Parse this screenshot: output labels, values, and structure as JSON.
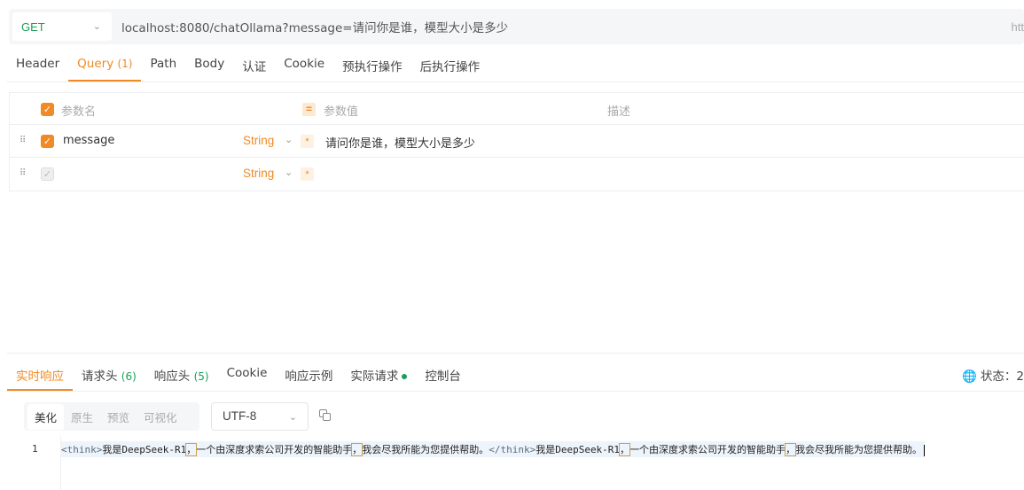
{
  "request": {
    "method": "GET",
    "url": "localhost:8080/chatOllama?message=请问你是谁，模型大小是多少",
    "url_overflow": "htt"
  },
  "request_tabs": [
    {
      "label": "Header",
      "count": ""
    },
    {
      "label": "Query",
      "count": "(1)"
    },
    {
      "label": "Path",
      "count": ""
    },
    {
      "label": "Body",
      "count": ""
    },
    {
      "label": "认证",
      "count": ""
    },
    {
      "label": "Cookie",
      "count": ""
    },
    {
      "label": "预执行操作",
      "count": ""
    },
    {
      "label": "后执行操作",
      "count": ""
    }
  ],
  "active_request_tab": "Query",
  "params": {
    "headers": {
      "name": "参数名",
      "value": "参数值",
      "desc": "描述"
    },
    "rows": [
      {
        "name": "message",
        "type": "String",
        "required_mark": "*",
        "value": "请问你是谁，模型大小是多少",
        "checked": true
      },
      {
        "name": "",
        "type": "String",
        "required_mark": "*",
        "value": "",
        "checked": false
      }
    ]
  },
  "response_tabs": [
    {
      "label": "实时响应",
      "count": ""
    },
    {
      "label": "请求头",
      "count": "(6)"
    },
    {
      "label": "响应头",
      "count": "(5)"
    },
    {
      "label": "Cookie",
      "count": ""
    },
    {
      "label": "响应示例",
      "count": ""
    },
    {
      "label": "实际请求",
      "count": ""
    },
    {
      "label": "控制台",
      "count": ""
    }
  ],
  "status_label": "状态：2",
  "format_buttons": [
    "美化",
    "原生",
    "预览",
    "可视化"
  ],
  "encoding": "UTF-8",
  "editor": {
    "line_number": "1",
    "open_tag": "<think>",
    "text1a": "我是DeepSeek-R1",
    "sep1": "，",
    "text1b": "一个由深度求索公司开发的智能助手",
    "sep2": "，",
    "text1c": "我会尽我所能为您提供帮助。",
    "close_tag": "</think>",
    "text2a": "我是DeepSeek-R1",
    "sep3": "，",
    "text2b": "一个由深度求索公司开发的智能助手",
    "sep4": "，",
    "text2c": "我会尽我所能为您提供帮助。"
  },
  "colors": {
    "accent": "#f08a24",
    "method_get": "#18a058"
  }
}
